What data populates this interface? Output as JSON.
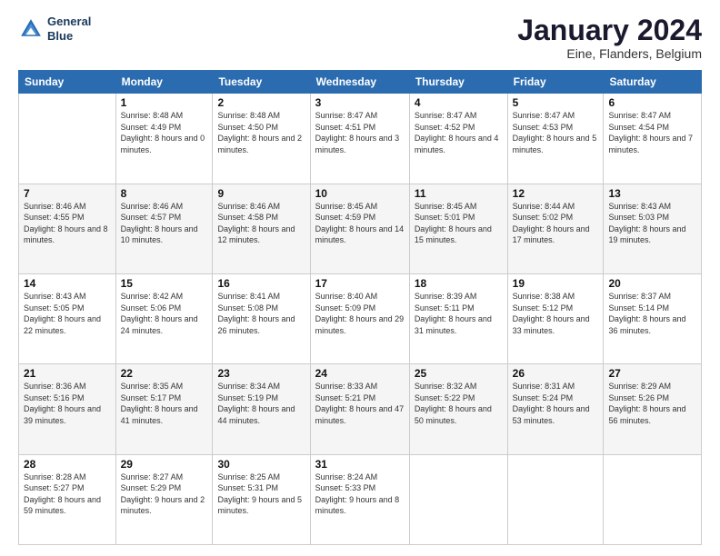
{
  "header": {
    "logo": {
      "line1": "General",
      "line2": "Blue"
    },
    "title": "January 2024",
    "subtitle": "Eine, Flanders, Belgium"
  },
  "weekdays": [
    "Sunday",
    "Monday",
    "Tuesday",
    "Wednesday",
    "Thursday",
    "Friday",
    "Saturday"
  ],
  "weeks": [
    [
      {
        "day": "",
        "sunrise": "",
        "sunset": "",
        "daylight": ""
      },
      {
        "day": "1",
        "sunrise": "Sunrise: 8:48 AM",
        "sunset": "Sunset: 4:49 PM",
        "daylight": "Daylight: 8 hours and 0 minutes."
      },
      {
        "day": "2",
        "sunrise": "Sunrise: 8:48 AM",
        "sunset": "Sunset: 4:50 PM",
        "daylight": "Daylight: 8 hours and 2 minutes."
      },
      {
        "day": "3",
        "sunrise": "Sunrise: 8:47 AM",
        "sunset": "Sunset: 4:51 PM",
        "daylight": "Daylight: 8 hours and 3 minutes."
      },
      {
        "day": "4",
        "sunrise": "Sunrise: 8:47 AM",
        "sunset": "Sunset: 4:52 PM",
        "daylight": "Daylight: 8 hours and 4 minutes."
      },
      {
        "day": "5",
        "sunrise": "Sunrise: 8:47 AM",
        "sunset": "Sunset: 4:53 PM",
        "daylight": "Daylight: 8 hours and 5 minutes."
      },
      {
        "day": "6",
        "sunrise": "Sunrise: 8:47 AM",
        "sunset": "Sunset: 4:54 PM",
        "daylight": "Daylight: 8 hours and 7 minutes."
      }
    ],
    [
      {
        "day": "7",
        "sunrise": "Sunrise: 8:46 AM",
        "sunset": "Sunset: 4:55 PM",
        "daylight": "Daylight: 8 hours and 8 minutes."
      },
      {
        "day": "8",
        "sunrise": "Sunrise: 8:46 AM",
        "sunset": "Sunset: 4:57 PM",
        "daylight": "Daylight: 8 hours and 10 minutes."
      },
      {
        "day": "9",
        "sunrise": "Sunrise: 8:46 AM",
        "sunset": "Sunset: 4:58 PM",
        "daylight": "Daylight: 8 hours and 12 minutes."
      },
      {
        "day": "10",
        "sunrise": "Sunrise: 8:45 AM",
        "sunset": "Sunset: 4:59 PM",
        "daylight": "Daylight: 8 hours and 14 minutes."
      },
      {
        "day": "11",
        "sunrise": "Sunrise: 8:45 AM",
        "sunset": "Sunset: 5:01 PM",
        "daylight": "Daylight: 8 hours and 15 minutes."
      },
      {
        "day": "12",
        "sunrise": "Sunrise: 8:44 AM",
        "sunset": "Sunset: 5:02 PM",
        "daylight": "Daylight: 8 hours and 17 minutes."
      },
      {
        "day": "13",
        "sunrise": "Sunrise: 8:43 AM",
        "sunset": "Sunset: 5:03 PM",
        "daylight": "Daylight: 8 hours and 19 minutes."
      }
    ],
    [
      {
        "day": "14",
        "sunrise": "Sunrise: 8:43 AM",
        "sunset": "Sunset: 5:05 PM",
        "daylight": "Daylight: 8 hours and 22 minutes."
      },
      {
        "day": "15",
        "sunrise": "Sunrise: 8:42 AM",
        "sunset": "Sunset: 5:06 PM",
        "daylight": "Daylight: 8 hours and 24 minutes."
      },
      {
        "day": "16",
        "sunrise": "Sunrise: 8:41 AM",
        "sunset": "Sunset: 5:08 PM",
        "daylight": "Daylight: 8 hours and 26 minutes."
      },
      {
        "day": "17",
        "sunrise": "Sunrise: 8:40 AM",
        "sunset": "Sunset: 5:09 PM",
        "daylight": "Daylight: 8 hours and 29 minutes."
      },
      {
        "day": "18",
        "sunrise": "Sunrise: 8:39 AM",
        "sunset": "Sunset: 5:11 PM",
        "daylight": "Daylight: 8 hours and 31 minutes."
      },
      {
        "day": "19",
        "sunrise": "Sunrise: 8:38 AM",
        "sunset": "Sunset: 5:12 PM",
        "daylight": "Daylight: 8 hours and 33 minutes."
      },
      {
        "day": "20",
        "sunrise": "Sunrise: 8:37 AM",
        "sunset": "Sunset: 5:14 PM",
        "daylight": "Daylight: 8 hours and 36 minutes."
      }
    ],
    [
      {
        "day": "21",
        "sunrise": "Sunrise: 8:36 AM",
        "sunset": "Sunset: 5:16 PM",
        "daylight": "Daylight: 8 hours and 39 minutes."
      },
      {
        "day": "22",
        "sunrise": "Sunrise: 8:35 AM",
        "sunset": "Sunset: 5:17 PM",
        "daylight": "Daylight: 8 hours and 41 minutes."
      },
      {
        "day": "23",
        "sunrise": "Sunrise: 8:34 AM",
        "sunset": "Sunset: 5:19 PM",
        "daylight": "Daylight: 8 hours and 44 minutes."
      },
      {
        "day": "24",
        "sunrise": "Sunrise: 8:33 AM",
        "sunset": "Sunset: 5:21 PM",
        "daylight": "Daylight: 8 hours and 47 minutes."
      },
      {
        "day": "25",
        "sunrise": "Sunrise: 8:32 AM",
        "sunset": "Sunset: 5:22 PM",
        "daylight": "Daylight: 8 hours and 50 minutes."
      },
      {
        "day": "26",
        "sunrise": "Sunrise: 8:31 AM",
        "sunset": "Sunset: 5:24 PM",
        "daylight": "Daylight: 8 hours and 53 minutes."
      },
      {
        "day": "27",
        "sunrise": "Sunrise: 8:29 AM",
        "sunset": "Sunset: 5:26 PM",
        "daylight": "Daylight: 8 hours and 56 minutes."
      }
    ],
    [
      {
        "day": "28",
        "sunrise": "Sunrise: 8:28 AM",
        "sunset": "Sunset: 5:27 PM",
        "daylight": "Daylight: 8 hours and 59 minutes."
      },
      {
        "day": "29",
        "sunrise": "Sunrise: 8:27 AM",
        "sunset": "Sunset: 5:29 PM",
        "daylight": "Daylight: 9 hours and 2 minutes."
      },
      {
        "day": "30",
        "sunrise": "Sunrise: 8:25 AM",
        "sunset": "Sunset: 5:31 PM",
        "daylight": "Daylight: 9 hours and 5 minutes."
      },
      {
        "day": "31",
        "sunrise": "Sunrise: 8:24 AM",
        "sunset": "Sunset: 5:33 PM",
        "daylight": "Daylight: 9 hours and 8 minutes."
      },
      {
        "day": "",
        "sunrise": "",
        "sunset": "",
        "daylight": ""
      },
      {
        "day": "",
        "sunrise": "",
        "sunset": "",
        "daylight": ""
      },
      {
        "day": "",
        "sunrise": "",
        "sunset": "",
        "daylight": ""
      }
    ]
  ]
}
